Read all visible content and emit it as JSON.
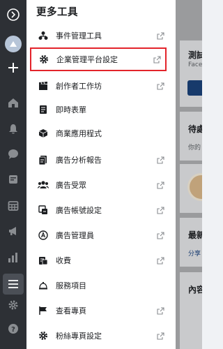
{
  "panel": {
    "title": "更多工具",
    "items": [
      {
        "label": "事件管理工具",
        "icon": "people-tree-icon",
        "external": true
      },
      {
        "label": "企業管理平台設定",
        "icon": "gear-icon",
        "external": true,
        "selected": true
      },
      {
        "label": "創作者工作坊",
        "icon": "clapperboard-icon",
        "external": true
      },
      {
        "label": "即時表單",
        "icon": "form-icon",
        "external": false
      },
      {
        "label": "商業應用程式",
        "icon": "cube-icon",
        "external": false
      },
      {
        "label": "廣告分析報告",
        "icon": "report-icon",
        "external": true
      },
      {
        "label": "廣告受眾",
        "icon": "audience-icon",
        "external": true
      },
      {
        "label": "廣告帳號設定",
        "icon": "ad-account-icon",
        "external": true
      },
      {
        "label": "廣告管理員",
        "icon": "ads-manager-icon",
        "external": true
      },
      {
        "label": "收費",
        "icon": "billing-icon",
        "external": true
      },
      {
        "label": "服務項目",
        "icon": "bell-service-icon",
        "external": false
      },
      {
        "label": "查看專頁",
        "icon": "flag-icon",
        "external": true
      },
      {
        "label": "粉絲專頁設定",
        "icon": "gear-icon",
        "external": true
      }
    ]
  },
  "background": {
    "title": "測試",
    "subtitle": "Face",
    "pending": "待處",
    "pending_sub": "你的",
    "latest": "最新",
    "share": "分享",
    "content": "內容"
  }
}
